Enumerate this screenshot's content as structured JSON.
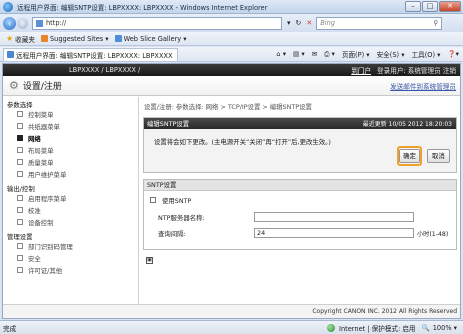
{
  "window": {
    "title": "远程用户界面: 编辑SNTP设置: LBPXXXX: LBPXXXX - Windows Internet Explorer",
    "controls": [
      "–",
      "□",
      "✕"
    ]
  },
  "address_bar": {
    "url": "http://",
    "search_placeholder": "Bing"
  },
  "favorites_bar": {
    "favorites_label": "收藏夹",
    "suggested_sites": "Suggested Sites ▾",
    "web_slice_gallery": "Web Slice Gallery ▾"
  },
  "tab": {
    "label": "远程用户界面: 编辑SNTP设置: LBPXXXX: LBPXXXX",
    "tools": [
      "页面(P) ▾",
      "安全(S) ▾",
      "工具(O) ▾"
    ]
  },
  "topbar": {
    "device": "LBPXXXX / LBPXXXX /",
    "portal_link": "到门户",
    "login_user": "登录用户: 系统管理员 注销"
  },
  "header": {
    "title": "设置/注册",
    "email_link": "发送邮件到系统管理员"
  },
  "sidebar": {
    "sections": [
      {
        "label": "参数选择",
        "items": [
          {
            "label": "控制菜单",
            "active": false
          },
          {
            "label": "共纸器菜单",
            "active": false
          },
          {
            "label": "网络",
            "active": true
          },
          {
            "label": "布局菜单",
            "active": false
          },
          {
            "label": "质量菜单",
            "active": false
          },
          {
            "label": "用户维护菜单",
            "active": false
          }
        ]
      },
      {
        "label": "输出/控制",
        "items": [
          {
            "label": "启用程序菜单",
            "active": false
          },
          {
            "label": "校准",
            "active": false
          },
          {
            "label": "设备控制",
            "active": false
          }
        ]
      },
      {
        "label": "管理设置",
        "items": [
          {
            "label": "部门识别码管理",
            "active": false
          },
          {
            "label": "安全",
            "active": false
          },
          {
            "label": "许可证/其他",
            "active": false
          }
        ]
      }
    ]
  },
  "main": {
    "breadcrumb": "设置/注册: 参数选择: 网络 > TCP/IP设置 > 编辑SNTP设置",
    "panel_title": "编辑SNTP设置",
    "last_updated": "最近更新 10/05 2012 18:20:03",
    "note": "设置将会如下更改。(主电源开关“关闭”再“打开”后,更改生效。)",
    "ok_button": "确定",
    "cancel_button": "取消",
    "sntp_section_title": "SNTP设置",
    "use_sntp_label": "使用SNTP",
    "use_sntp_checked": false,
    "ntp_server_label": "NTP服务器名称:",
    "ntp_server_value": "",
    "interval_label": "查询间隔:",
    "interval_value": "24",
    "interval_suffix": "小时(1-48)",
    "top_icon": "▣"
  },
  "footer": {
    "copyright": "Copyright CANON INC. 2012 All Rights Reserved"
  },
  "status_bar": {
    "status": "完成",
    "zone": "Internet | 保护模式: 启用",
    "zoom": "100% ▾"
  },
  "colors": {
    "highlight": "#f0a12b",
    "dark_bar": "#2a2a2a",
    "link": "#3656a8"
  }
}
